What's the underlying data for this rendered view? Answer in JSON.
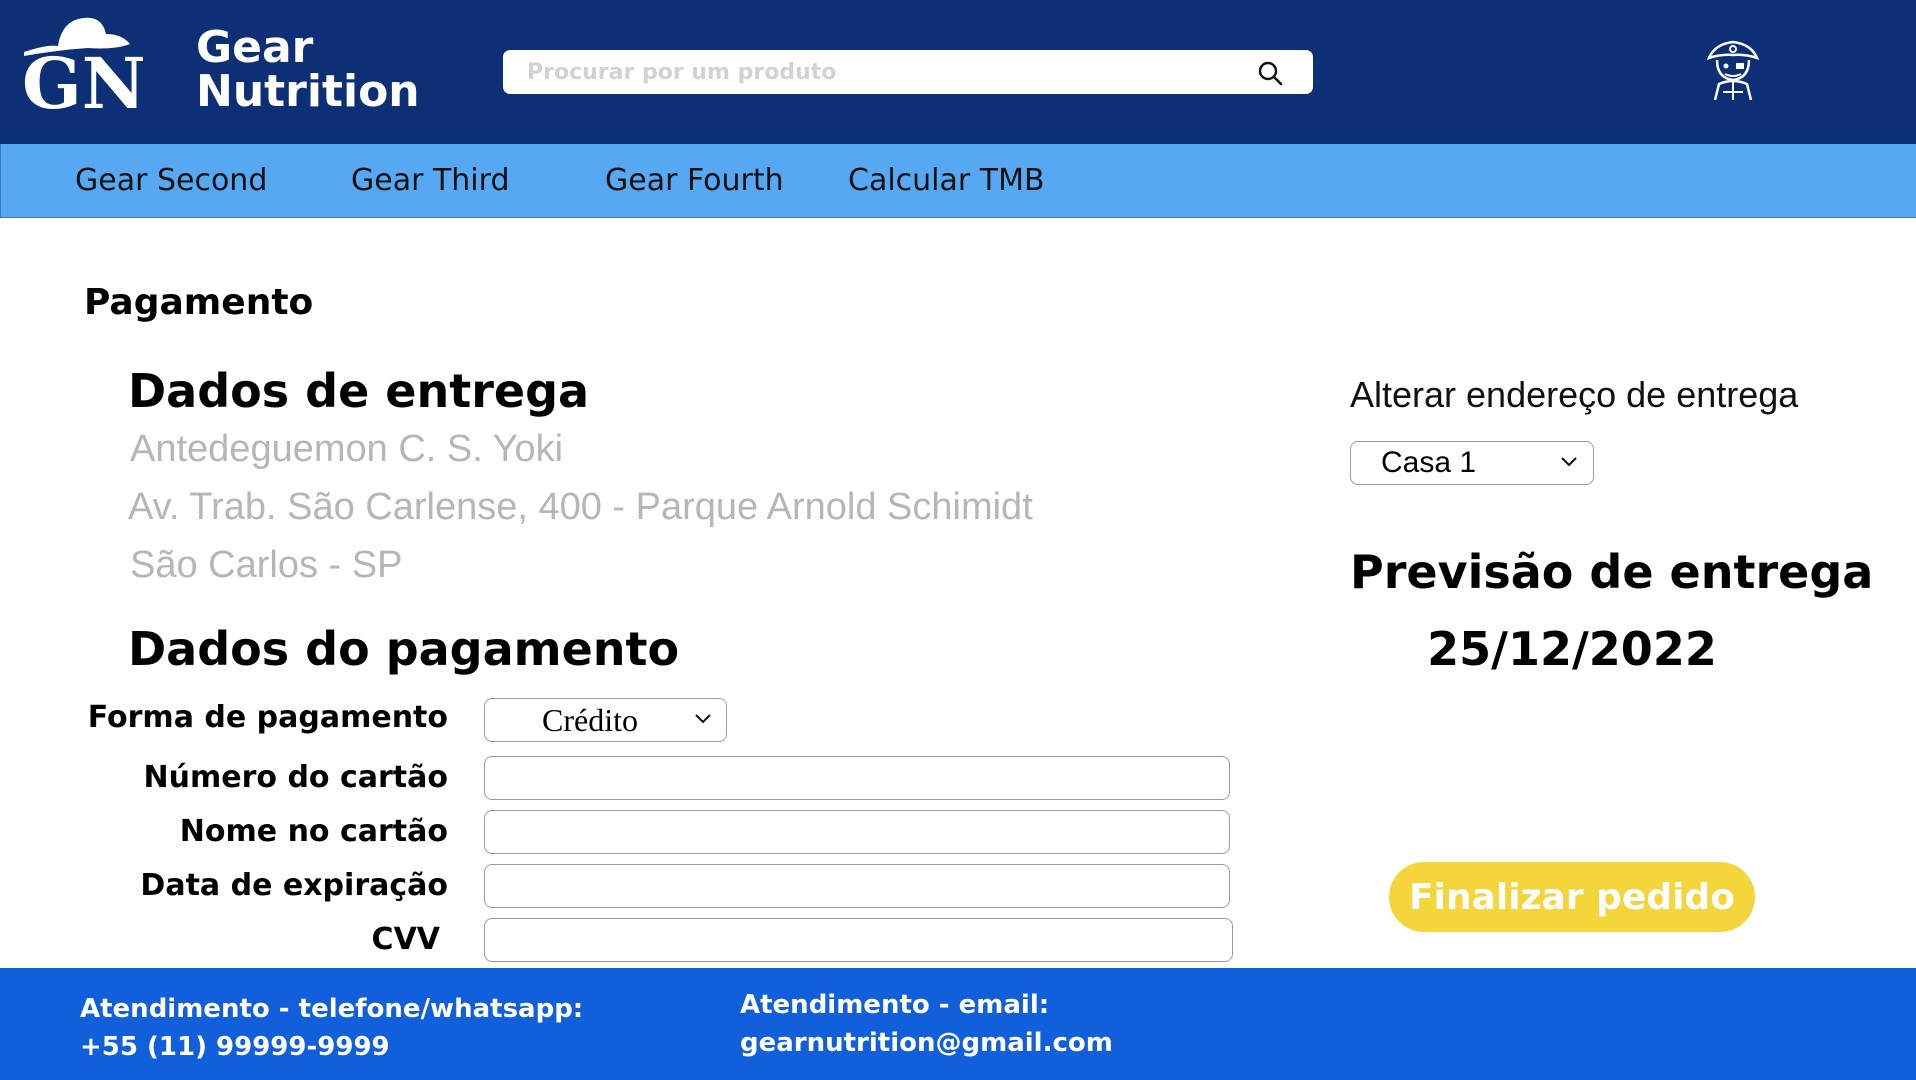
{
  "header": {
    "brand_line1": "Gear",
    "brand_line2": "Nutrition",
    "logo_text": "GN",
    "search_placeholder": "Procurar por um produto",
    "search_icon": "search-icon",
    "avatar_icon": "pirate-avatar-icon"
  },
  "nav": {
    "items": [
      {
        "label": "Gear Second"
      },
      {
        "label": "Gear Third"
      },
      {
        "label": "Gear Fourth"
      },
      {
        "label": "Calcular TMB"
      }
    ]
  },
  "main": {
    "page_title": "Pagamento",
    "delivery": {
      "title": "Dados de entrega",
      "name": "Antedeguemon C. S. Yoki",
      "street": "Av. Trab. São Carlense, 400 - Parque Arnold Schimidt",
      "city": "São Carlos - SP"
    },
    "payment": {
      "title": "Dados do pagamento",
      "method_label": "Forma de pagamento",
      "method_value": "Crédito",
      "card_number_label": "Número do cartão",
      "card_name_label": "Nome no cartão",
      "expiry_label": "Data de expiração",
      "cvv_label": "CVV",
      "card_number_value": "",
      "card_name_value": "",
      "expiry_value": "",
      "cvv_value": ""
    },
    "right": {
      "change_address_label": "Alterar endereço de entrega",
      "address_select_value": "Casa 1",
      "forecast_title": "Previsão de entrega",
      "forecast_date": "25/12/2022",
      "finalize_label": "Finalizar pedido"
    }
  },
  "footer": {
    "phone_label": "Atendimento - telefone/whatsapp:",
    "phone_value": "+55 (11) 99999-9999",
    "email_label": "Atendimento - email:",
    "email_value": "gearnutrition@gmail.com"
  },
  "colors": {
    "header_bg": "#0c2f75",
    "nav_bg": "#56a8f3",
    "footer_bg": "#125fdb",
    "accent_button": "#f4d63b",
    "address_text": "#b6b6b6"
  }
}
